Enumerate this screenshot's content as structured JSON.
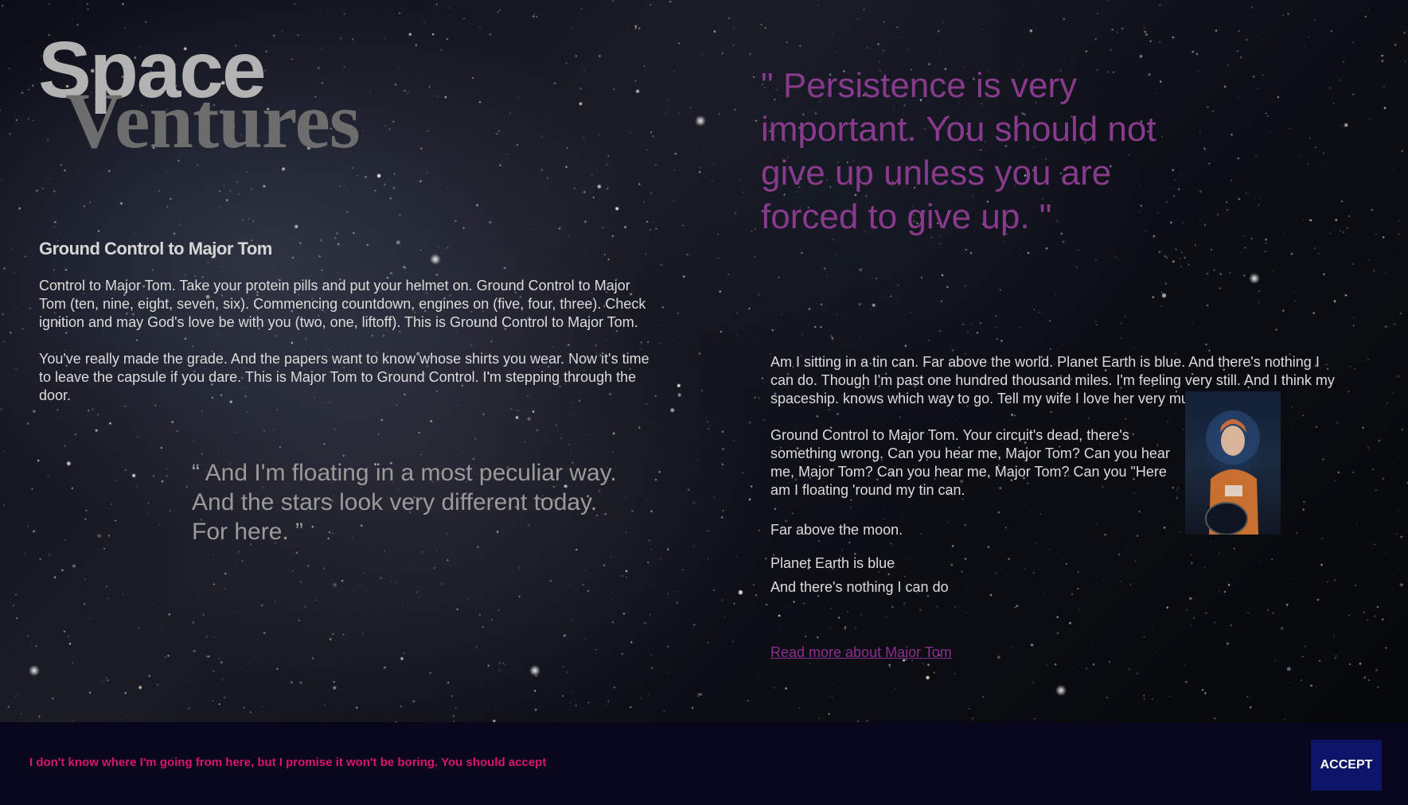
{
  "title": {
    "line1": "Space",
    "line2": "Ventures"
  },
  "left": {
    "heading": "Ground Control to Major Tom",
    "paragraph1": "Control to Major Tom. Take your protein pills and put your helmet on. Ground Control to Major Tom (ten, nine, eight, seven, six). Commencing countdown, engines on (five, four, three). Check ignition and may God's love be with you (two, one, liftoff). This is Ground Control to Major Tom.",
    "paragraph2": "You've really made the grade. And the papers want to know whose shirts you wear. Now it's time to leave the capsule if you dare. This is Major Tom to Ground Control. I'm stepping through the door.",
    "quote": "“ And I'm floating in a most peculiar way. And the stars look very different today. For here. ”"
  },
  "right": {
    "quote": "\" Persistence is very important. You should not give up unless you are forced to give up. \"",
    "paragraph1": "Am I sitting in a tin can. Far above the world. Planet Earth is blue. And there's nothing I can do. Though I'm past one hundred thousand miles. I'm feeling very still. And I think my spaceship. knows which way to go. Tell my wife I love her very much she knows.",
    "paragraph2": "Ground Control to Major Tom. Your circuit's dead, there's something wrong. Can you hear me, Major Tom? Can you hear me, Major Tom? Can you hear me, Major Tom? Can you \"Here am I floating 'round my tin can.",
    "line1": "Far above the moon.",
    "line2": "Planet Earth is blue",
    "line3": "And there's nothing I can do",
    "link": "Read more about Major Tom",
    "quote_color": "#8a3a8c",
    "link_color": "#8b2f8f"
  },
  "cookie": {
    "message": "I don't know where I'm going from here, but I promise it won't be boring. You should accept",
    "accept_label": "ACCEPT",
    "background": "#06061d",
    "text_color": "#d8176a",
    "button_color": "#0d1468"
  },
  "icons": {
    "portrait": "astronaut-portrait-icon"
  }
}
